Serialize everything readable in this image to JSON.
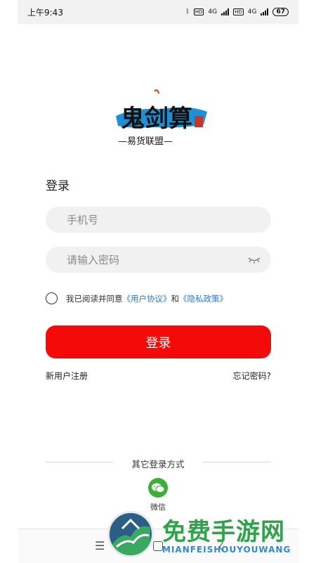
{
  "status_bar": {
    "time": "上午9:43",
    "network_1": "4G",
    "hd_1": "HD",
    "network_2": "4G",
    "hd_2": "HD",
    "battery": "67"
  },
  "logo": {
    "text_main": "鬼剑算",
    "text_sub": "—易货联盟—"
  },
  "login": {
    "title": "登录",
    "phone_placeholder": "手机号",
    "password_placeholder": "请输入密码",
    "agree_prefix": "我已阅读并同意",
    "user_agreement": "《用户协议》",
    "and": "和",
    "privacy_policy": "《隐私政策》",
    "submit_label": "登录",
    "register_link": "新用户注册",
    "forgot_link": "忘记密码?"
  },
  "other_login": {
    "heading": "其它登录方式",
    "wechat_label": "微信"
  },
  "nav": {
    "menu_glyph": "☰",
    "back_glyph": "〈"
  },
  "watermark": {
    "title": "免费手游网",
    "subtitle": "MIANFEISHOUYOUWANG"
  },
  "colors": {
    "accent_red": "#f50a0a",
    "link_blue": "#2a78c8",
    "wechat_green": "#3cb034"
  }
}
